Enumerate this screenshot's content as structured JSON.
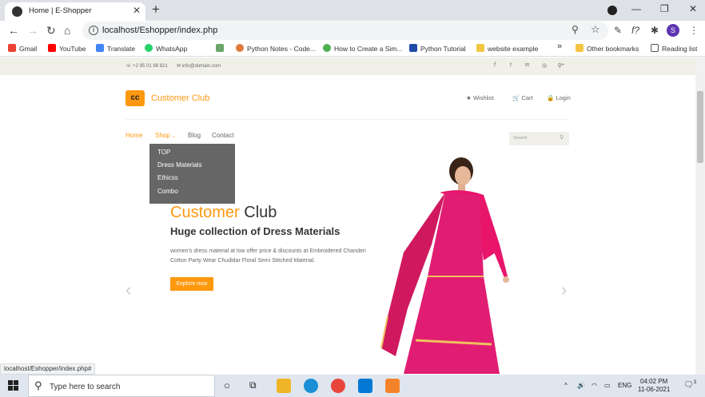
{
  "browser": {
    "tab_title": "Home | E-Shopper",
    "tab_close": "✕",
    "new_tab": "+",
    "url": "localhost/Eshopper/index.php",
    "bookmarks": [
      {
        "label": "Gmail",
        "color": "#ea4335"
      },
      {
        "label": "YouTube",
        "color": "#ff0000"
      },
      {
        "label": "Translate",
        "color": "#4285f4"
      },
      {
        "label": "WhatsApp",
        "color": "#25d366"
      },
      {
        "label": "",
        "color": "#6aa66a"
      },
      {
        "label": "Python Notes - Code...",
        "color": "#e07a3a"
      },
      {
        "label": "How to Create a Sim...",
        "color": "#4caf50"
      },
      {
        "label": "Python Tutorial",
        "color": "#1e4aa8"
      },
      {
        "label": "website example",
        "color": "#f5c542"
      },
      {
        "label": "»",
        "color": ""
      },
      {
        "label": "Other bookmarks",
        "color": "#f5c542"
      },
      {
        "label": "Reading list",
        "color": "#555555"
      }
    ],
    "profile_initial": "S",
    "status_url": "localhost/Eshopper/index.php#"
  },
  "site": {
    "contact": {
      "phone": "+2 95 01 88 821",
      "email": "info@domain.com"
    },
    "social": [
      "f",
      "t",
      "in",
      "◎",
      "g+"
    ],
    "logo_text": "cc",
    "brand": "Customer Club",
    "header_links": [
      "Wishlist",
      "Cart",
      "Login"
    ],
    "nav": [
      "Home",
      "Shop",
      "Blog",
      "Contact"
    ],
    "search_placeholder": "Search",
    "shop_menu": [
      "TOP",
      "Dress Materials",
      "Ethicss",
      "Combo"
    ],
    "hero": {
      "title_a": "Customer",
      "title_b": " Club",
      "subtitle": "Huge collection of Dress Materials",
      "description": "women's dress material at low offer price & discounts at Embroidered Chanderi Cotton Party Wear Chudidar Floral Semi Stitched Material.",
      "button": "Explore now"
    },
    "accent_color": "#fe980f"
  },
  "taskbar": {
    "search_placeholder": "Type here to search",
    "language": "ENG",
    "time": "04:02 PM",
    "date": "11-06-2021",
    "notification_count": "3"
  }
}
